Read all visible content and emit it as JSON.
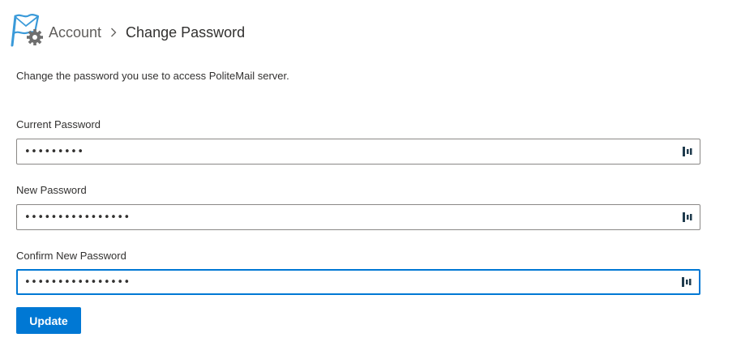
{
  "breadcrumb": {
    "parent": "Account",
    "current": "Change Password"
  },
  "description": "Change the password you use to access PoliteMail server.",
  "fields": {
    "current_password": {
      "label": "Current Password",
      "value": "•••••••••"
    },
    "new_password": {
      "label": "New Password",
      "value": "••••••••••••••••"
    },
    "confirm_password": {
      "label": "Confirm New Password",
      "value": "••••••••••••••••"
    }
  },
  "actions": {
    "update_label": "Update"
  },
  "icons": {
    "logo": "politemail-flag-gear-icon",
    "separator": "chevron-right-icon",
    "password_manager": "password-manager-icon"
  },
  "colors": {
    "accent": "#0078d4",
    "logo_blue": "#3a9ad9",
    "gear_gray": "#6e6e6e"
  }
}
